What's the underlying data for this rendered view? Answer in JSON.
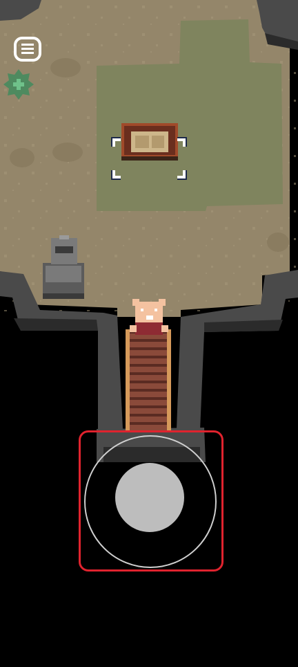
{
  "colors": {
    "ground": "#94866a",
    "grass": "#7f845e",
    "rock": "#4a4a4a",
    "rock_dark": "#2b2b2b",
    "bridge": "#8a4a3a",
    "bridge_rail": "#d69a5a",
    "joystick_outline": "#e0232e",
    "joystick_knob": "#bdbdbd",
    "add_button": "#4e8a5f"
  },
  "icons": {
    "menu": "hamburger-menu-icon",
    "add": "plus-icon",
    "target": "selection-brackets-icon"
  }
}
